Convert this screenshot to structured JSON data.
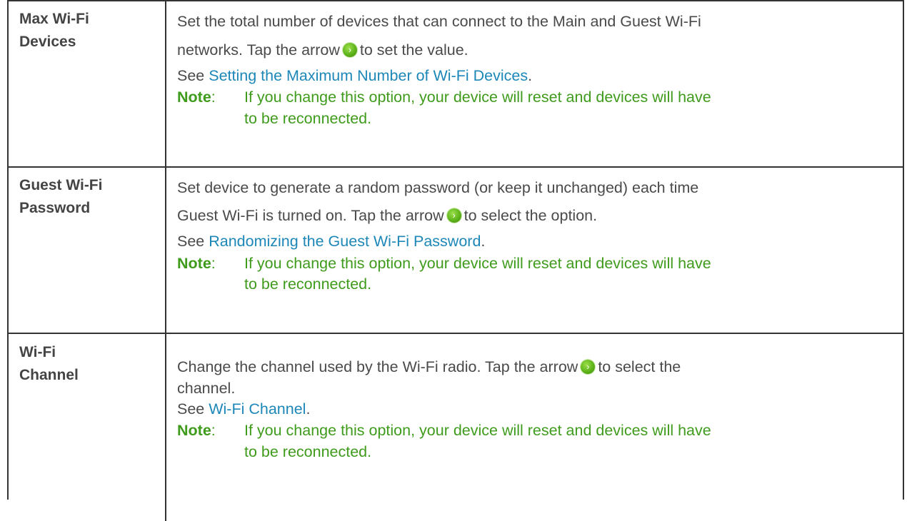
{
  "rows": [
    {
      "label_line1": "Max Wi-Fi",
      "label_line2": "Devices",
      "desc_line1": "Set the total number of devices that can connect to the Main and Guest Wi-Fi",
      "desc_line2a": "networks. Tap the arrow",
      "desc_line2b": "to set the value.",
      "see_prefix": "See ",
      "see_link": "Setting the Maximum Number of Wi-Fi Devices",
      "see_suffix": ".",
      "note_label": "Note",
      "note_colon": ":",
      "note_line1": "If you change this option, your device will reset and devices will have",
      "note_line2": "to be reconnected."
    },
    {
      "label_line1": "Guest Wi-Fi",
      "label_line2": "Password",
      "desc_line1": "Set device to generate a random password (or keep it unchanged) each time",
      "desc_line2a": "Guest Wi-Fi is turned on. Tap the arrow",
      "desc_line2b": "to select the option.",
      "see_prefix": "See ",
      "see_link": "Randomizing the Guest Wi-Fi Password",
      "see_suffix": ".",
      "note_label": "Note",
      "note_colon": ":",
      "note_line1": "If you change this option, your device will reset and devices will have",
      "note_line2": "to be reconnected."
    },
    {
      "label_line1": "Wi-Fi",
      "label_line2": "Channel",
      "desc_line1a": "Change the channel used by the Wi-Fi radio. Tap the arrow",
      "desc_line1b": "to select the",
      "desc_line2": "channel.",
      "see_prefix": "See ",
      "see_link": "Wi-Fi Channel",
      "see_suffix": ".",
      "note_label": "Note",
      "note_colon": ":",
      "note_line1": "If you change this option, your device will reset and devices will have",
      "note_line2": "to be reconnected."
    }
  ],
  "icons": {
    "arrow": "green-arrow-right-icon",
    "arrow_glyph": "›",
    "arrow_color": "#5fb41a"
  },
  "colors": {
    "link": "#1d87b8",
    "note": "#3f9b1c",
    "text": "#444444",
    "border": "#333333"
  }
}
